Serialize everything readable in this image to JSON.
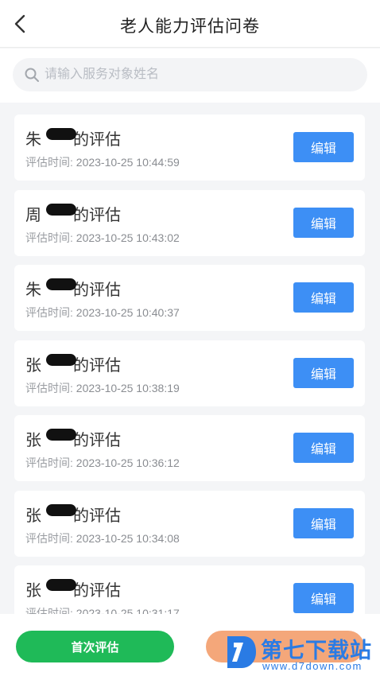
{
  "header": {
    "title": "老人能力评估问卷"
  },
  "search": {
    "placeholder": "请输入服务对象姓名"
  },
  "list": {
    "time_label": "评估时间:",
    "edit_label": "编辑",
    "items": [
      {
        "surname": "朱",
        "suffix": "的评估",
        "time": "2023-10-25 10:44:59"
      },
      {
        "surname": "周",
        "suffix": "的评估",
        "time": "2023-10-25 10:43:02"
      },
      {
        "surname": "朱",
        "suffix": "的评估",
        "time": "2023-10-25 10:40:37"
      },
      {
        "surname": "张",
        "suffix": "的评估",
        "time": "2023-10-25 10:38:19"
      },
      {
        "surname": "张",
        "suffix": "的评估",
        "time": "2023-10-25 10:36:12"
      },
      {
        "surname": "张",
        "suffix": "的评估",
        "time": "2023-10-25 10:34:08"
      },
      {
        "surname": "张",
        "suffix": "的评估",
        "time": "2023-10-25 10:31:17"
      }
    ]
  },
  "footer": {
    "first_eval_label": "首次评估"
  },
  "watermark": {
    "title": "第七下载站",
    "url": "www.d7down.com"
  },
  "colors": {
    "edit_button": "#3d8ff5",
    "first_eval_button": "#1fba58",
    "second_button": "#f4a77a",
    "watermark": "#2a7be4"
  }
}
